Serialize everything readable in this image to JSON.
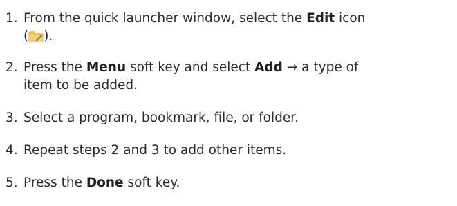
{
  "steps": [
    {
      "number": "1.",
      "line1_pre": "From the quick launcher window, select the ",
      "line1_bold": "Edit",
      "line1_post": " icon",
      "line2_pre": "(",
      "icon": "folder-edit-icon",
      "line2_post": ")."
    },
    {
      "number": "2.",
      "line1_pre": "Press the ",
      "line1_bold1": "Menu",
      "line1_mid": " soft key and select ",
      "line1_bold2": "Add",
      "line1_post": " → a type of",
      "line2": "item to be added."
    },
    {
      "number": "3.",
      "text": "Select a program, bookmark, file, or folder."
    },
    {
      "number": "4.",
      "text": "Repeat steps 2 and 3 to add other items."
    },
    {
      "number": "5.",
      "pre": "Press the ",
      "bold": "Done",
      "post": " soft key."
    }
  ],
  "colors": {
    "text": "#2b2b2b",
    "folder": "#f2c35a",
    "folder_dark": "#d9a22c"
  }
}
